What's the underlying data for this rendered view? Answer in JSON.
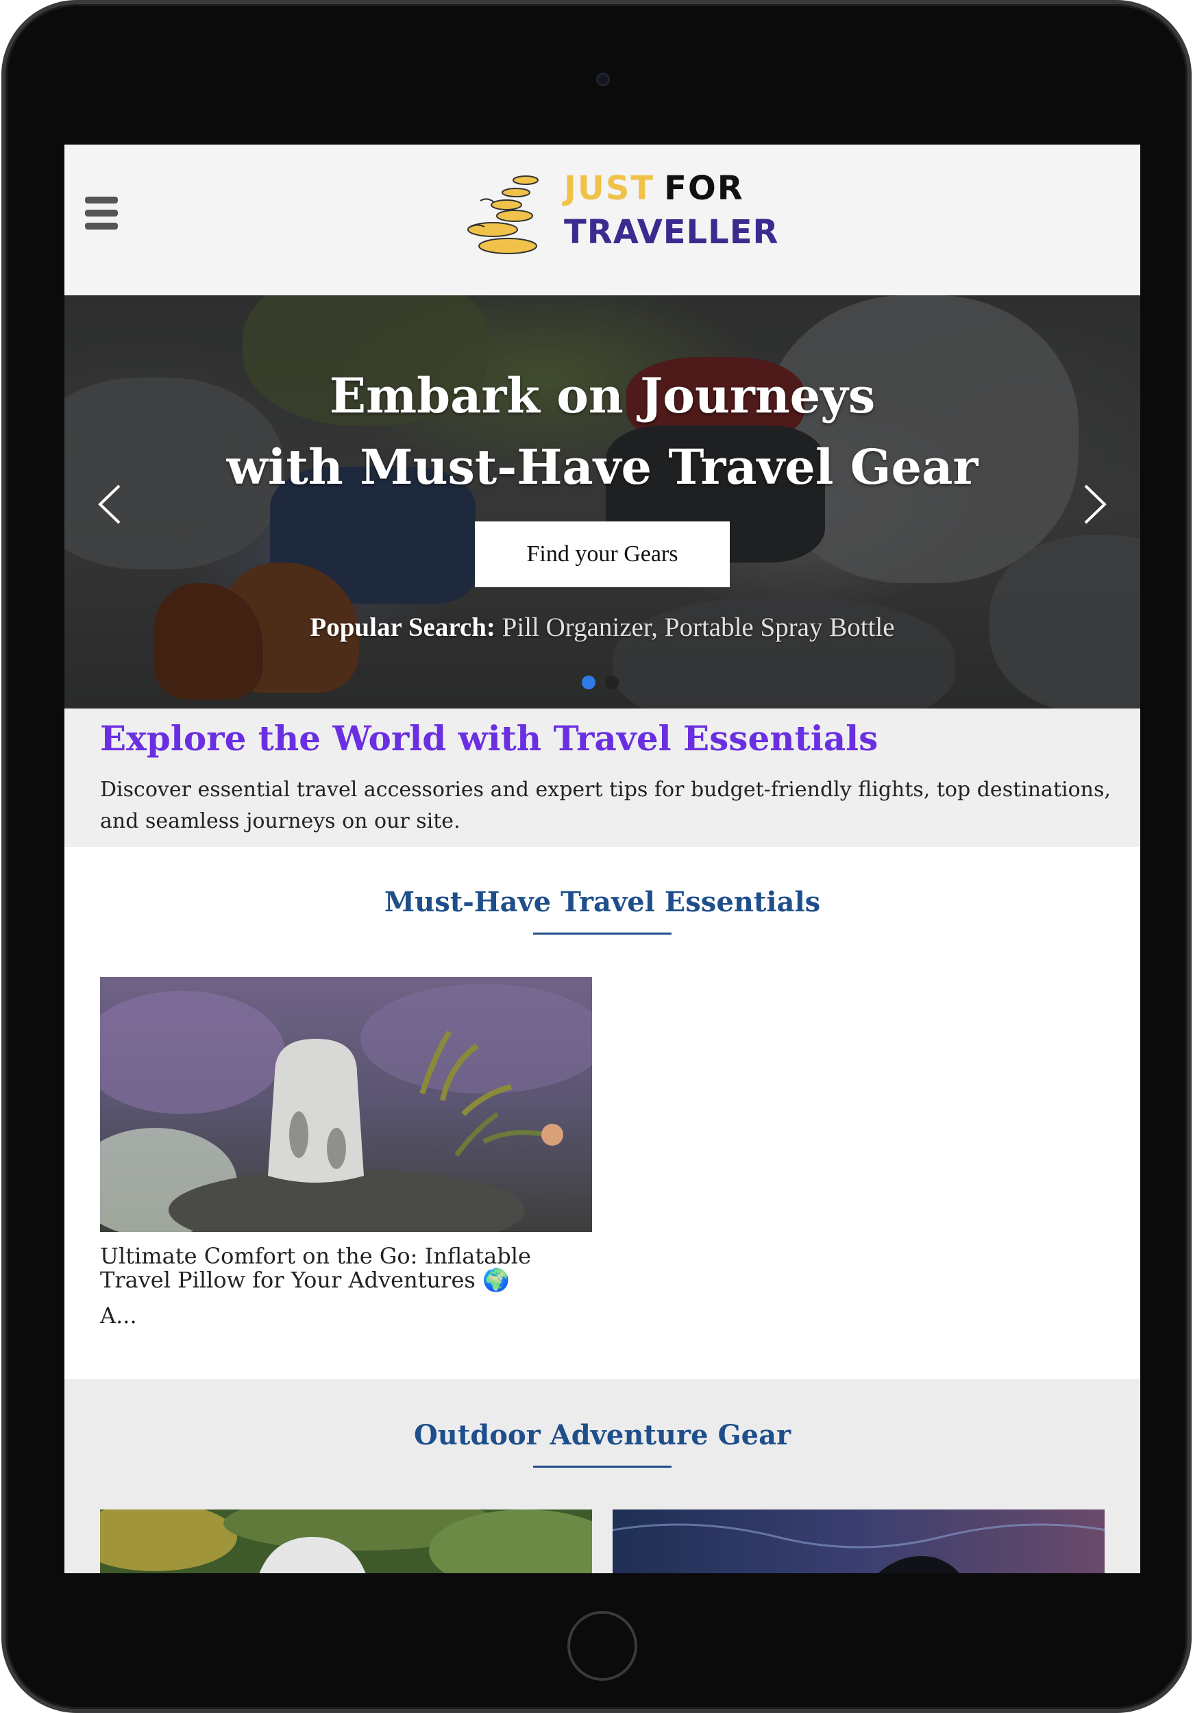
{
  "header": {
    "menu_icon": "hamburger-menu-icon",
    "logo": {
      "line1_a": "JUST",
      "line1_b": "FOR",
      "line2": "TRAVELLER"
    }
  },
  "hero": {
    "title_line1": "Embark on Journeys",
    "title_line2": "with Must-Have Travel Gear",
    "button_label": "Find your Gears",
    "popular_label": "Popular Search:",
    "popular_links": [
      "Pill Organizer",
      "Portable Spray Bottle"
    ],
    "popular_separator": ", ",
    "prev_icon": "chevron-left-icon",
    "next_icon": "chevron-right-icon",
    "slides_total": 2,
    "slide_active": 1,
    "colors": {
      "dot_active": "#2f7be8",
      "dot_inactive": "#222222"
    }
  },
  "intro": {
    "title": "Explore the World with Travel Essentials",
    "text": "Discover essential travel accessories and expert tips for budget-friendly flights, top destinations, and seamless journeys on our site."
  },
  "sections": {
    "essentials": {
      "title": "Must-Have Travel Essentials",
      "cards": [
        {
          "title": "Ultimate Comfort on the Go: Inflatable Travel Pillow for Your Adventures 🌍",
          "excerpt": "A..."
        }
      ]
    },
    "outdoor": {
      "title": "Outdoor Adventure Gear"
    }
  },
  "colors": {
    "accent_purple": "#6a2fe0",
    "section_blue": "#1f4f8b",
    "logo_yellow": "#f0c24a",
    "logo_indigo": "#3d2a8f"
  }
}
